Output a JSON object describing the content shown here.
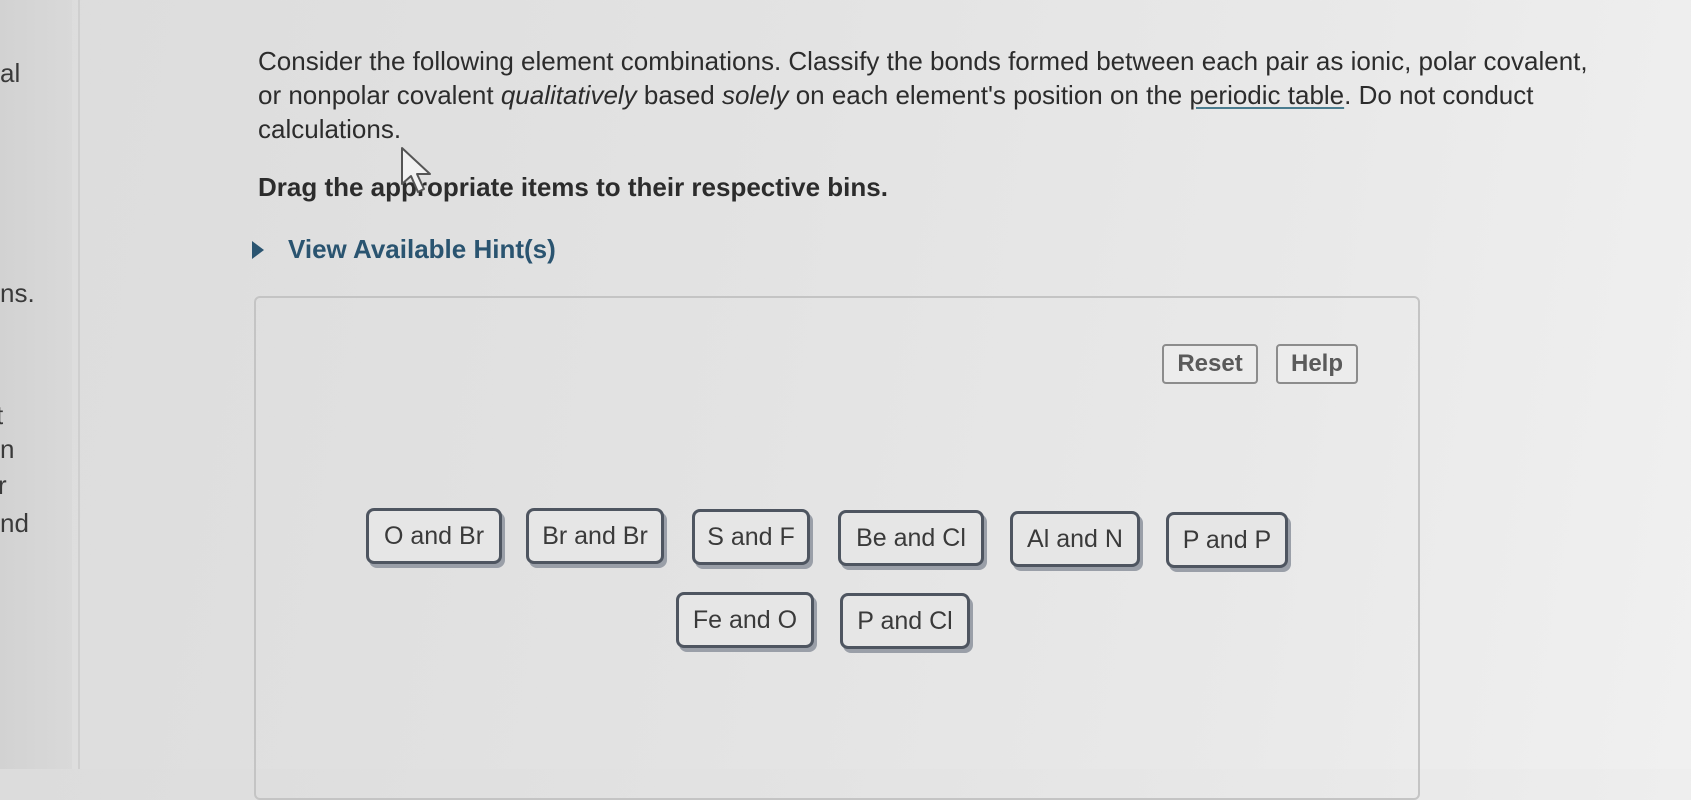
{
  "sidebar": {
    "fragments": [
      "al",
      "ns.",
      "t",
      "n",
      "r",
      "nd"
    ]
  },
  "question": {
    "part1": "Consider the following element combinations. Classify the bonds formed between each pair as ionic, polar covalent, or nonpolar covalent ",
    "qualitatively": "qualitatively",
    "part2": " based ",
    "solely": "solely",
    "part3": " on each element's position on the ",
    "link": "periodic table",
    "part4": ". Do not conduct calculations."
  },
  "instruction": "Drag the appropriate items to their respective bins.",
  "hint": {
    "label": "View Available Hint(s)",
    "icon": "triangle-right-icon"
  },
  "toolbar": {
    "reset_label": "Reset",
    "help_label": "Help"
  },
  "items": [
    "O and Br",
    "Br and Br",
    "S and F",
    "Be and Cl",
    "Al and N",
    "P and P",
    "Fe and O",
    "P and Cl"
  ],
  "colors": {
    "hint_accent": "#2a5470",
    "tile_border": "#4e5560",
    "background": "#e3e3e3"
  }
}
